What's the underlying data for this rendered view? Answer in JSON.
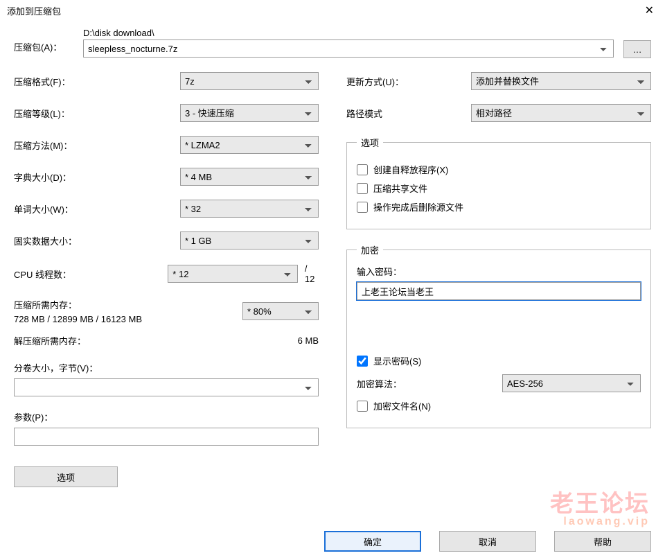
{
  "window": {
    "title": "添加到压缩包",
    "close_glyph": "✕"
  },
  "archive": {
    "label": "压缩包(A)：",
    "dir": "D:\\disk download\\",
    "filename": "sleepless_nocturne.7z",
    "browse": "…"
  },
  "left": {
    "format_label": "压缩格式(F)：",
    "format_value": "7z",
    "level_label": "压缩等级(L)：",
    "level_value": "3 - 快速压缩",
    "method_label": "压缩方法(M)：",
    "method_value": "* LZMA2",
    "dict_label": "字典大小(D)：",
    "dict_value": "* 4 MB",
    "word_label": "单词大小(W)：",
    "word_value": "* 32",
    "solid_label": "固实数据大小：",
    "solid_value": "* 1 GB",
    "cpu_label": "CPU 线程数：",
    "cpu_value": "* 12",
    "cpu_total": "/ 12",
    "compress_mem_label": "压缩所需内存：",
    "compress_mem_detail": "728 MB / 12899 MB / 16123 MB",
    "compress_mem_pct": "* 80%",
    "decompress_mem_label": "解压缩所需内存：",
    "decompress_mem_value": "6 MB",
    "volume_label": "分卷大小，字节(V)：",
    "volume_value": "",
    "params_label": "参数(P)：",
    "params_value": "",
    "options_btn": "选项"
  },
  "right": {
    "update_label": "更新方式(U)：",
    "update_value": "添加并替换文件",
    "path_label": "路径模式",
    "path_value": "相对路径",
    "options_legend": "选项",
    "opt_sfx": "创建自释放程序(X)",
    "opt_shared": "压缩共享文件",
    "opt_delete": "操作完成后删除源文件",
    "encrypt_legend": "加密",
    "pwd_label": "输入密码：",
    "pwd_value": "上老王论坛当老王",
    "show_pwd": "显示密码(S)",
    "enc_method_label": "加密算法：",
    "enc_method_value": "AES-256",
    "enc_filenames": "加密文件名(N)"
  },
  "footer": {
    "ok": "确定",
    "cancel": "取消",
    "help": "帮助"
  },
  "watermark": {
    "line1": "老王论坛",
    "line2": "laowang.vip"
  }
}
